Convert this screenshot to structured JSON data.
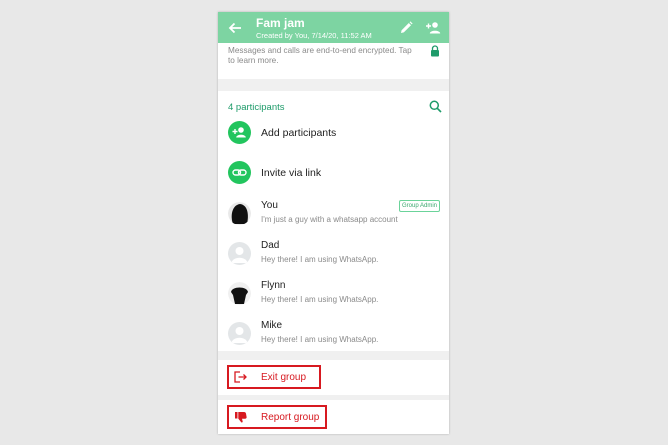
{
  "header": {
    "title": "Fam jam",
    "subtitle": "Created by You, 7/14/20, 11:52 AM",
    "bar_color": "#7dd4a2"
  },
  "encryption": {
    "text": "Messages and calls are end-to-end encrypted. Tap to learn more."
  },
  "participants": {
    "count_label": "4 participants",
    "accent_color": "#1e9b6a",
    "actions": [
      {
        "label": "Add participants",
        "icon": "add-person-icon"
      },
      {
        "label": "Invite via link",
        "icon": "link-icon"
      }
    ],
    "members": [
      {
        "name": "You",
        "status": "I'm just a guy with a whatsapp account",
        "badge": "Group Admin"
      },
      {
        "name": "Dad",
        "status": "Hey there! I am using WhatsApp."
      },
      {
        "name": "Flynn",
        "status": "Hey there! I am using WhatsApp."
      },
      {
        "name": "Mike",
        "status": "Hey there! I am using WhatsApp."
      }
    ]
  },
  "exit": {
    "label": "Exit group",
    "icon": "exit-icon"
  },
  "report": {
    "label": "Report group",
    "icon": "thumbs-down-icon"
  },
  "danger_color": "#d71920"
}
